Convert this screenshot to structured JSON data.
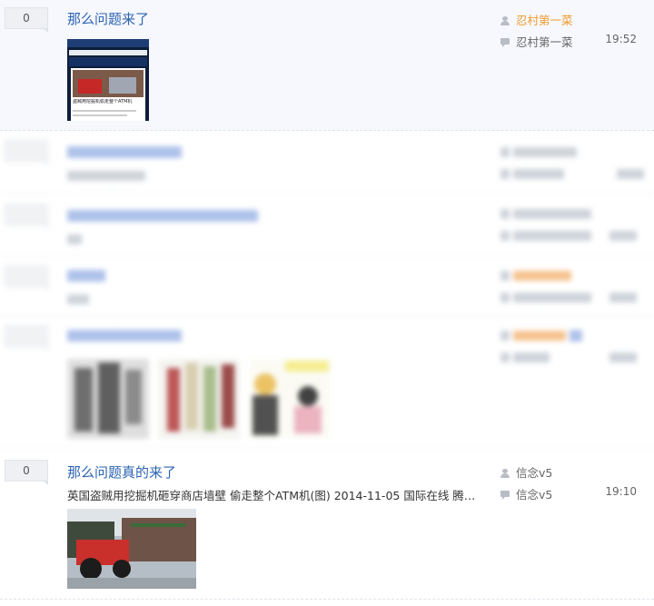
{
  "threads": [
    {
      "reply_count": "0",
      "title": "那么问题来了",
      "author": "忍村第一菜",
      "last_replier": "忍村第一菜",
      "time": "19:52",
      "colors": {
        "author": "#f09a2e"
      }
    },
    {
      "reply_count": "0",
      "title": "那么问题真的来了",
      "abstract": "英国盗贼用挖掘机砸穿商店墙壁 偷走整个ATM机(图) 2014-11-05 国际在线 腾讯新...",
      "author": "信念v5",
      "last_replier": "信念v5",
      "time": "19:10"
    }
  ],
  "image_card": {
    "caption": "盗贼用挖掘机偷走整个ATM机"
  }
}
